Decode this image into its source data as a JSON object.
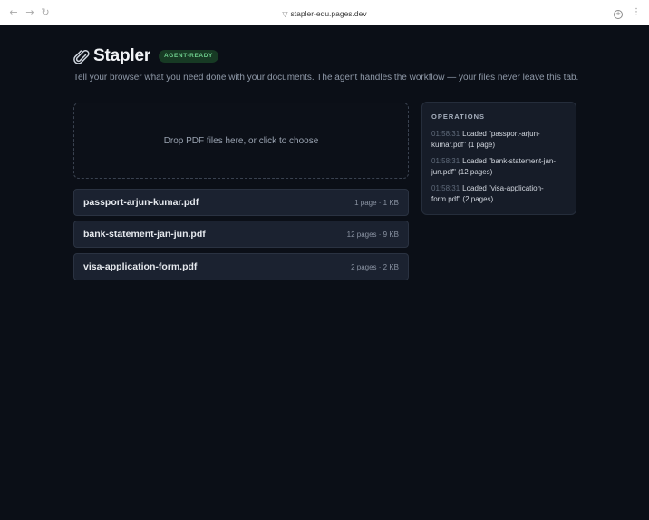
{
  "browser": {
    "url": "stapler-equ.pages.dev",
    "back_icon": "back-arrow-icon",
    "forward_icon": "forward-arrow-icon",
    "reload_icon": "reload-icon"
  },
  "header": {
    "title": "Stapler",
    "badge": "AGENT-READY",
    "tagline": "Tell your browser what you need done with your documents. The agent handles the workflow — your files never leave this tab."
  },
  "dropzone": {
    "label": "Drop PDF files here, or click to choose"
  },
  "files": [
    {
      "name": "passport-arjun-kumar.pdf",
      "meta": "1 page · 1 KB"
    },
    {
      "name": "bank-statement-jan-jun.pdf",
      "meta": "12 pages · 9 KB"
    },
    {
      "name": "visa-application-form.pdf",
      "meta": "2 pages · 2 KB"
    }
  ],
  "operations": {
    "title": "OPERATIONS",
    "entries": [
      {
        "time": "01:58:31",
        "text": "Loaded \"passport-arjun-kumar.pdf\" (1 page)"
      },
      {
        "time": "01:58:31",
        "text": "Loaded \"bank-statement-jan-jun.pdf\" (12 pages)"
      },
      {
        "time": "01:58:31",
        "text": "Loaded \"visa-application-form.pdf\" (2 pages)"
      }
    ]
  },
  "colors": {
    "background": "#0b0f17",
    "badge_bg": "#173a24",
    "badge_text": "#6fd08e",
    "card_bg": "#1b2230"
  }
}
